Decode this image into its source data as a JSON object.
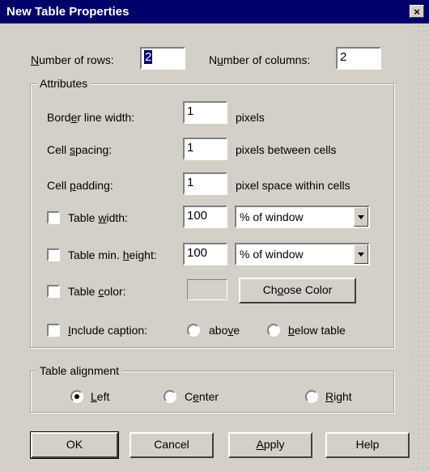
{
  "window": {
    "title": "New Table Properties",
    "close_glyph": "×"
  },
  "rows": {
    "label_pre": "",
    "label_key": "N",
    "label_post": "umber of rows:",
    "value": "2"
  },
  "columns": {
    "label_pre": "N",
    "label_key": "u",
    "label_post": "mber of columns:",
    "value": "2"
  },
  "attributes": {
    "title": "Attributes",
    "border": {
      "label_pre": "Bord",
      "label_key": "e",
      "label_post": "r line width:",
      "value": "1",
      "unit": "pixels"
    },
    "spacing": {
      "label_pre": "Cell ",
      "label_key": "s",
      "label_post": "pacing:",
      "value": "1",
      "unit": "pixels between cells"
    },
    "padding": {
      "label_pre": "Cell ",
      "label_key": "p",
      "label_post": "adding:",
      "value": "1",
      "unit": "pixel space within cells"
    },
    "width": {
      "label_pre": "Table ",
      "label_key": "w",
      "label_post": "idth:",
      "value": "100",
      "unit": "% of window",
      "checked": false
    },
    "height": {
      "label_pre": "Table min. ",
      "label_key": "h",
      "label_post": "eight:",
      "value": "100",
      "unit": "% of window",
      "checked": false
    },
    "color": {
      "label_pre": "Table ",
      "label_key": "c",
      "label_post": "olor:",
      "button_pre": "Ch",
      "button_key": "o",
      "button_post": "ose Color",
      "checked": false
    },
    "caption": {
      "label_pre": "",
      "label_key": "I",
      "label_post": "nclude caption:",
      "checked": false,
      "above_pre": "abo",
      "above_key": "v",
      "above_post": "e",
      "below_pre": "",
      "below_key": "b",
      "below_post": "elow table"
    }
  },
  "alignment": {
    "title": "Table alignment",
    "left": {
      "pre": "",
      "key": "L",
      "post": "eft",
      "checked": true
    },
    "center": {
      "pre": "C",
      "key": "e",
      "post": "nter",
      "checked": false
    },
    "right": {
      "pre": "",
      "key": "R",
      "post": "ight",
      "checked": false
    }
  },
  "buttons": {
    "ok": "OK",
    "cancel": "Cancel",
    "apply_pre": "",
    "apply_key": "A",
    "apply_post": "pply",
    "help": "Help"
  }
}
